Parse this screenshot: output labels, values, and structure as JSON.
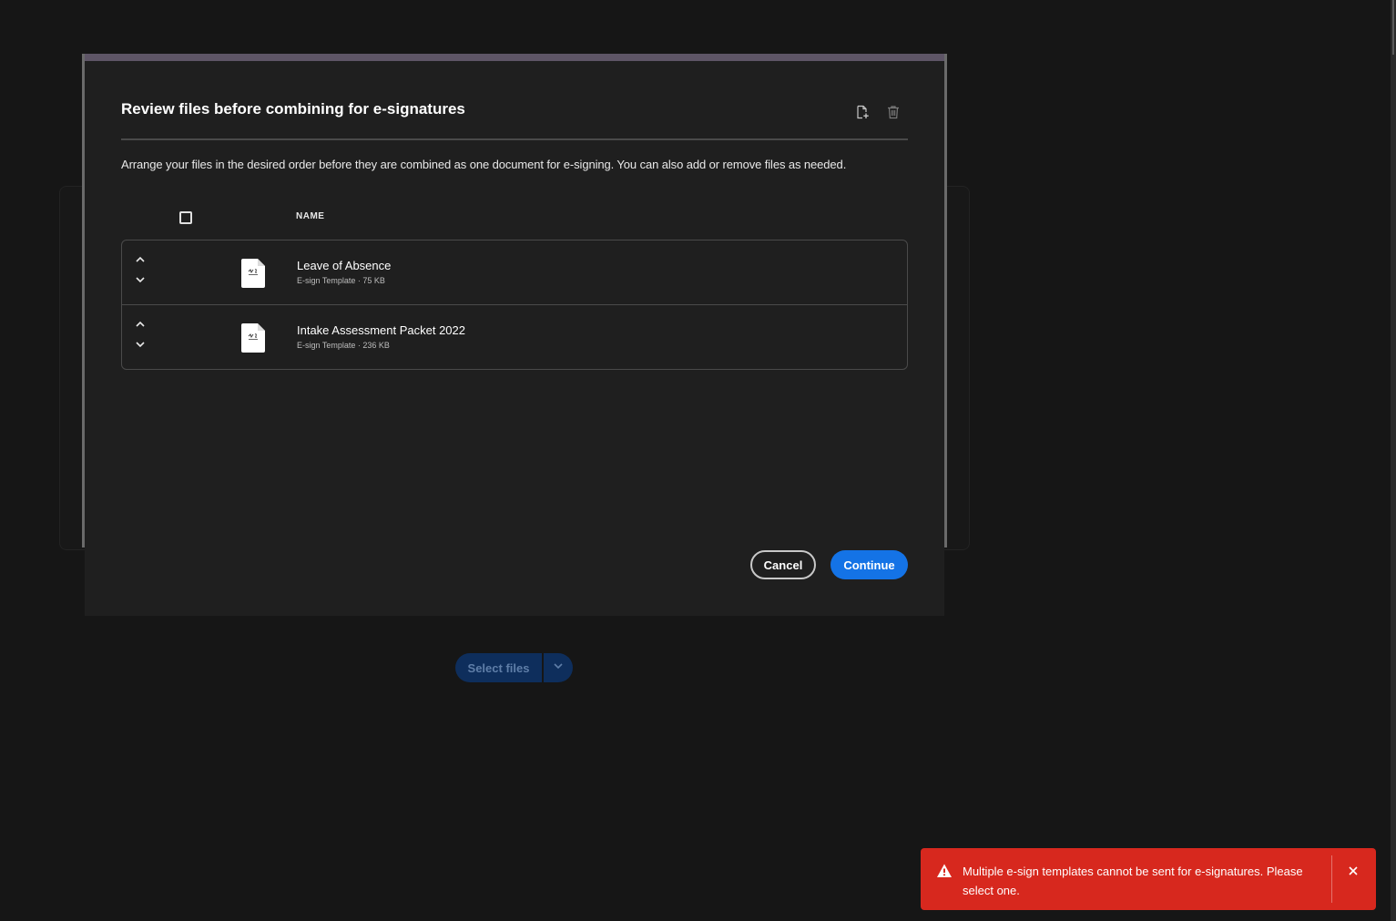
{
  "modal": {
    "title": "Review files before combining for e-signatures",
    "description": "Arrange your files in the desired order before they are combined as one document for e-signing. You can also add or remove files as needed.",
    "header_icons": [
      "add-file-icon",
      "trash-icon"
    ],
    "column_name": "NAME",
    "files": [
      {
        "name": "Leave of Absence",
        "meta": "E-sign Template · 75 KB"
      },
      {
        "name": "Intake Assessment Packet 2022",
        "meta": "E-sign Template · 236 KB"
      }
    ],
    "cancel_label": "Cancel",
    "continue_label": "Continue"
  },
  "background": {
    "select_files_label": "Select files"
  },
  "toast": {
    "message": "Multiple e-sign templates cannot be sent for e-signatures. Please select one.",
    "color": "#d7281e"
  },
  "colors": {
    "accent": "#1473e6",
    "background": "#161616",
    "modal": "#1f1f1f"
  }
}
